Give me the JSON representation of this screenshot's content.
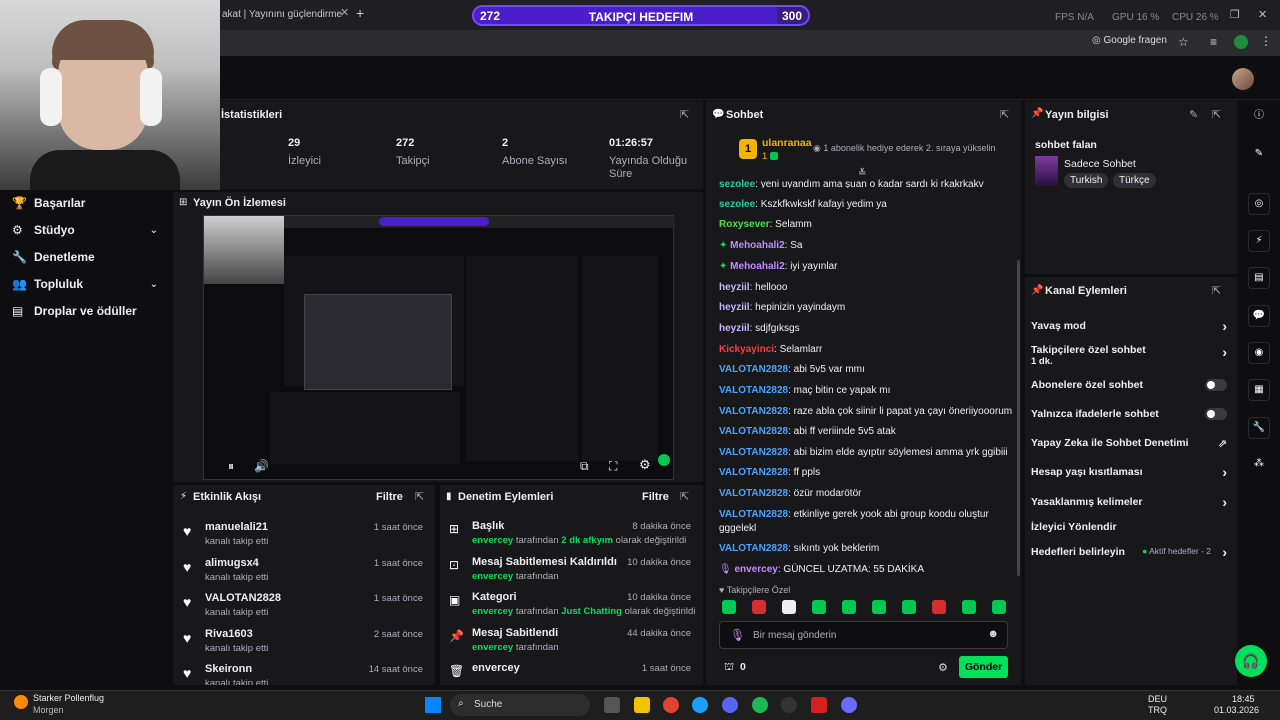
{
  "browser": {
    "tab_title": "akat | Yayınını güçlendirme",
    "tab_close": "✕",
    "new_tab": "+",
    "google_button": "Google fragen"
  },
  "goal": {
    "current": 272,
    "target": 300,
    "label": "TAKIPÇI HEDEFIM",
    "progress_fraction": 0.9067
  },
  "perf": {
    "fps": "FPS N/A",
    "gpu": "GPU 16 %",
    "cpu": "CPU 26 %"
  },
  "nav": {
    "items": [
      {
        "label": "Başarılar",
        "icon": "trophy-icon",
        "chevron": false
      },
      {
        "label": "Stüdyo",
        "icon": "studio-icon",
        "chevron": true
      },
      {
        "label": "Denetleme",
        "icon": "wrench-icon",
        "chevron": false
      },
      {
        "label": "Topluluk",
        "icon": "community-icon",
        "chevron": true
      },
      {
        "label": "Droplar ve ödüller",
        "icon": "drops-icon",
        "chevron": false
      }
    ]
  },
  "stats": {
    "title": "İstatistikleri",
    "items": [
      {
        "value": "29",
        "label": "İzleyici"
      },
      {
        "value": "272",
        "label": "Takipçi"
      },
      {
        "value": "2",
        "label": "Abone Sayısı"
      },
      {
        "value": "01:26:57",
        "label": "Yayında Olduğu Süre"
      }
    ]
  },
  "preview": {
    "title": "Yayın Ön İzlemesi"
  },
  "activity": {
    "title": "Etkinlik Akışı",
    "filter": "Filtre",
    "items": [
      {
        "name": "manuelali21",
        "sub": "kanalı takip etti",
        "time": "1 saat önce"
      },
      {
        "name": "alimugsx4",
        "sub": "kanalı takip etti",
        "time": "1 saat önce"
      },
      {
        "name": "VALOTAN2828",
        "sub": "kanalı takip etti",
        "time": "1 saat önce"
      },
      {
        "name": "Riva1603",
        "sub": "kanalı takip etti",
        "time": "2 saat önce"
      },
      {
        "name": "Skeironn",
        "sub": "kanalı takip etti",
        "time": "14 saat önce"
      }
    ]
  },
  "modlog": {
    "title": "Denetim Eylemleri",
    "filter": "Filtre",
    "items": [
      {
        "name": "Başlık",
        "who": "envercey",
        "mid": " tarafından ",
        "hl": "2 dk afkyım",
        "tail": " olarak değiştirildi",
        "time": "8 dakika önce"
      },
      {
        "name": "Mesaj Sabitlemesi Kaldırıldı",
        "who": "envercey",
        "mid": " tarafından",
        "hl": "",
        "tail": "",
        "time": "10 dakika önce"
      },
      {
        "name": "Kategori",
        "who": "envercey",
        "mid": " tarafından ",
        "hl": "Just Chatting",
        "tail": " olarak değiştirildi",
        "time": "10 dakika önce"
      },
      {
        "name": "Mesaj Sabitlendi",
        "who": "envercey",
        "mid": " tarafından",
        "hl": "",
        "tail": "",
        "time": "44 dakika önce"
      },
      {
        "name": "envercey",
        "who": "",
        "mid": "",
        "hl": "",
        "tail": "",
        "time": "1 saat önce"
      }
    ]
  },
  "chat": {
    "title": "Sohbet",
    "top_user": "ulanranaa",
    "top_rank": "1",
    "top_count": "1",
    "promo": "1 abonelik hediye ederek 2. sıraya yükselin",
    "messages": [
      {
        "user": "sezolee",
        "color": "#1fd1a0",
        "text": ": yeni uyandım ama şuan o kadar sardı ki rkakrkakv"
      },
      {
        "user": "sezolee",
        "color": "#1fd1a0",
        "text": ": Kszkfkwkskf kafayi yedim ya"
      },
      {
        "user": "Roxysever",
        "color": "#4ce04c",
        "text": ": Selamm"
      },
      {
        "user": "Mehoahali2",
        "color": "#c38cff",
        "text": ": Sa"
      },
      {
        "user": "Mehoahali2",
        "color": "#c38cff",
        "text": ": iyi yayınlar"
      },
      {
        "user": "heyziil",
        "color": "#c6b6ff",
        "text": ": hellooo"
      },
      {
        "user": "heyziil",
        "color": "#c6b6ff",
        "text": ": hepinizin yayindaym"
      },
      {
        "user": "heyziil",
        "color": "#c6b6ff",
        "text": ": sdjfgıksgs"
      },
      {
        "user": "Kickyayinci",
        "color": "#ff3b3b",
        "text": ": Selamlarr"
      },
      {
        "user": "VALOTAN2828",
        "color": "#4aa3ff",
        "text": ": abi 5v5 var mmı"
      },
      {
        "user": "VALOTAN2828",
        "color": "#4aa3ff",
        "text": ": maç bitin ce yapak mı"
      },
      {
        "user": "VALOTAN2828",
        "color": "#4aa3ff",
        "text": ": raze abla çok siinir li papat ya çayı öneriiyooorum"
      },
      {
        "user": "VALOTAN2828",
        "color": "#4aa3ff",
        "text": ": abi ff veriiinde 5v5 atak"
      },
      {
        "user": "VALOTAN2828",
        "color": "#4aa3ff",
        "text": ": abi bizim elde ayıptır söylemesi amma yrk ggibiii"
      },
      {
        "user": "VALOTAN2828",
        "color": "#4aa3ff",
        "text": ": ff ppls"
      },
      {
        "user": "VALOTAN2828",
        "color": "#4aa3ff",
        "text": ": özür modarötör"
      },
      {
        "user": "VALOTAN2828",
        "color": "#4aa3ff",
        "text": ": etkinliye gerek yook abi group koodu oluştur gggelekl"
      },
      {
        "user": "VALOTAN2828",
        "color": "#4aa3ff",
        "text": ": sıkıntı yok beklerim"
      },
      {
        "user": "envercey",
        "color": "#c38cff",
        "text": ": GÜNCEL UZATMA: 55 DAKİKA"
      }
    ],
    "followers_only": "Takipçilere Özel",
    "input_placeholder": "Bir mesaj gönderin",
    "points": "0",
    "send": "Gönder"
  },
  "stream_info": {
    "title": "Yayın bilgisi",
    "stream_title": "sohbet falan",
    "category": "Sadece Sohbet",
    "tags": [
      "Turkish",
      "Türkçe"
    ]
  },
  "channel_actions": {
    "title": "Kanal Eylemleri",
    "items": [
      {
        "label": "Yavaş mod",
        "kind": "arrow",
        "sub": ""
      },
      {
        "label": "Takipçilere özel sohbet",
        "kind": "arrow",
        "sub": "1 dk."
      },
      {
        "label": "Abonelere özel sohbet",
        "kind": "toggle",
        "sub": ""
      },
      {
        "label": "Yalnızca ifadelerle sohbet",
        "kind": "toggle",
        "sub": ""
      },
      {
        "label": "Yapay Zeka ile Sohbet Denetimi",
        "kind": "ext",
        "sub": ""
      },
      {
        "label": "Hesap yaşı kısıtlaması",
        "kind": "arrow",
        "sub": ""
      },
      {
        "label": "Yasaklanmış kelimeler",
        "kind": "arrow",
        "sub": ""
      },
      {
        "label": "İzleyici Yönlendir",
        "kind": "none",
        "sub": ""
      },
      {
        "label": "Hedefleri belirleyin",
        "kind": "arrow",
        "sub": "Aktif hedefler - 2"
      }
    ]
  },
  "taskbar": {
    "weather_title": "Starker Pollenflug",
    "weather_sub": "Morgen",
    "search": "Suche",
    "lang1": "DEU",
    "lang2": "TRQ",
    "time": "18:45",
    "date": "01.03.2026"
  }
}
